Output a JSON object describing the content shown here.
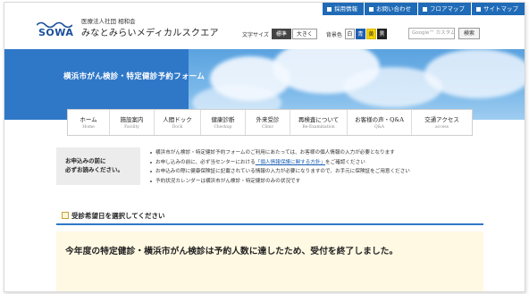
{
  "topbar": [
    {
      "label": "採用情報",
      "icon": "person-icon"
    },
    {
      "label": "お問い合わせ",
      "icon": "mail-icon"
    },
    {
      "label": "フロアマップ",
      "icon": "map-icon"
    },
    {
      "label": "サイトマップ",
      "icon": "sitemap-icon"
    }
  ],
  "header": {
    "logo_text": "SOWA",
    "org_name": "医療法人社団 相和会",
    "site_name": "みなとみらいメディカルスクエア",
    "font_size_label": "文字サイズ",
    "font_standard": "標準",
    "font_large": "大きく",
    "bg_color_label": "背景色",
    "bg_white": "白",
    "bg_blue": "青",
    "bg_yellow": "黄",
    "bg_black": "黒",
    "search_placeholder": "Google™ カスタム検索",
    "search_button": "検索"
  },
  "banner": {
    "title": "横浜市がん検診・特定健診予約フォーム"
  },
  "nav": [
    {
      "jp": "ホーム",
      "en": "Home"
    },
    {
      "jp": "施設案内",
      "en": "Facility"
    },
    {
      "jp": "人間ドック",
      "en": "Dock"
    },
    {
      "jp": "健康診断",
      "en": "Checkup"
    },
    {
      "jp": "外来受診",
      "en": "Clinic"
    },
    {
      "jp": "再検査について",
      "en": "Re-Examination"
    },
    {
      "jp": "お客様の声・Q&A",
      "en": "Q&A"
    },
    {
      "jp": "交通アクセス",
      "en": "access"
    }
  ],
  "notice": {
    "label_line1": "お申込みの前に",
    "label_line2": "必ずお読みください。",
    "items": [
      "横浜市がん検診・特定健診予約フォームのご利用にあたっては、お客様の個人情報の入力が必要となります",
      "お申し込みの前に、必ず当センターにおける",
      "お申込みの際に健康保険証に記載されている情報の入力が必要になりますので、お手元に保険証をご用意ください",
      "予約状況カレンダーは横浜市がん検診・特定健診のみの状況です"
    ],
    "link_text": "「個人情報保護に関する方針」",
    "item2_suffix": "をご確認ください"
  },
  "section": {
    "title": "受診希望日を選択してください"
  },
  "closed_message": "今年度の特定健診・横浜市がん検診は予約人数に達したため、受付を終了しました。"
}
